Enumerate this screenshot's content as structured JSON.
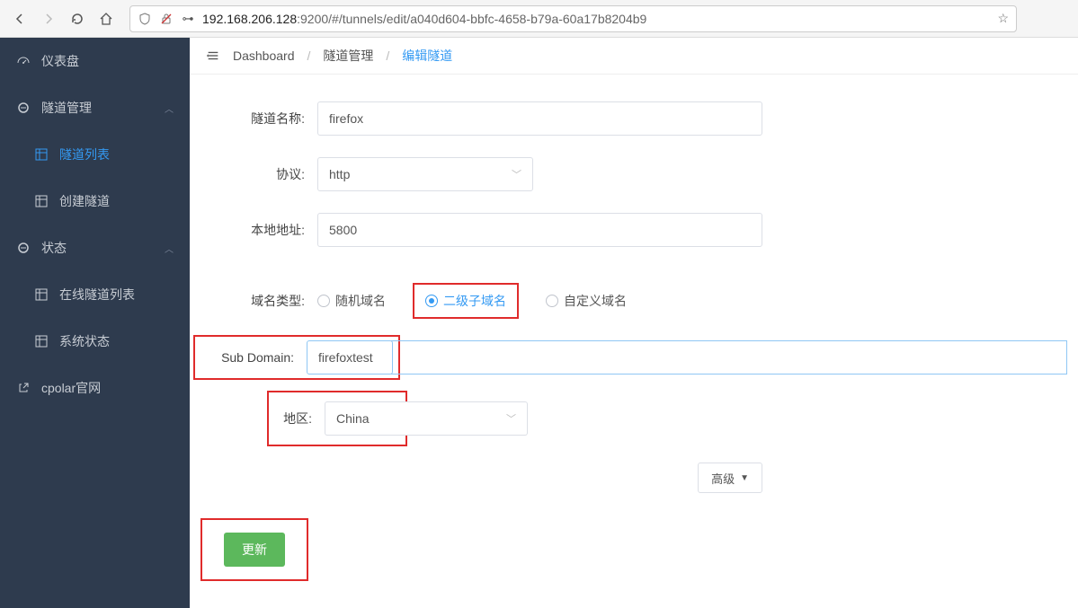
{
  "browser": {
    "url_host": "192.168.206.128",
    "url_path": ":9200/#/tunnels/edit/a040d604-bbfc-4658-b79a-60a17b8204b9"
  },
  "sidebar": {
    "dashboard": "仪表盘",
    "tunnel_mgmt": "隧道管理",
    "tunnel_list": "隧道列表",
    "create_tunnel": "创建隧道",
    "status": "状态",
    "online_list": "在线隧道列表",
    "sys_status": "系统状态",
    "cpolar_site": "cpolar官网"
  },
  "breadcrumb": {
    "a": "Dashboard",
    "b": "隧道管理",
    "c": "编辑隧道"
  },
  "form": {
    "name_label": "隧道名称:",
    "name_value": "firefox",
    "protocol_label": "协议:",
    "protocol_value": "http",
    "local_addr_label": "本地地址:",
    "local_addr_value": "5800",
    "domain_type_label": "域名类型:",
    "domain_opts": {
      "random": "随机域名",
      "sub": "二级子域名",
      "custom": "自定义域名"
    },
    "subdomain_label": "Sub Domain:",
    "subdomain_value": "firefoxtest",
    "region_label": "地区:",
    "region_value": "China",
    "advanced": "高级",
    "submit": "更新"
  }
}
